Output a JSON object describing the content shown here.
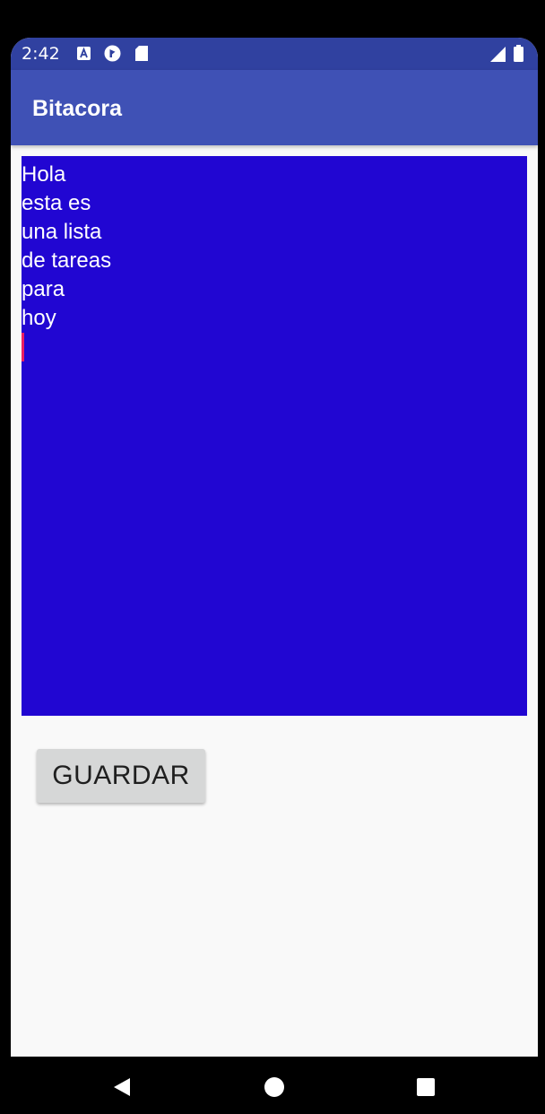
{
  "status_bar": {
    "time": "2:42",
    "icons_left": [
      "text-a-icon",
      "drive-icon",
      "sd-card-icon"
    ],
    "icons_right": [
      "signal-icon",
      "battery-icon"
    ]
  },
  "app_bar": {
    "title": "Bitacora"
  },
  "editor": {
    "text": "Hola\nesta es\nuna lista\nde tareas\npara\nhoy",
    "background_color": "#2106d2",
    "text_color": "#ffffff",
    "caret_color": "#e91e63"
  },
  "save_button": {
    "label": "GUARDAR"
  },
  "nav_bar": {
    "buttons": [
      "back-icon",
      "home-icon",
      "recents-icon"
    ]
  },
  "colors": {
    "status_bar": "#3041a0",
    "app_bar": "#3f51b5",
    "screen_background": "#f9f9f9",
    "button_background": "#d6d7d7"
  }
}
